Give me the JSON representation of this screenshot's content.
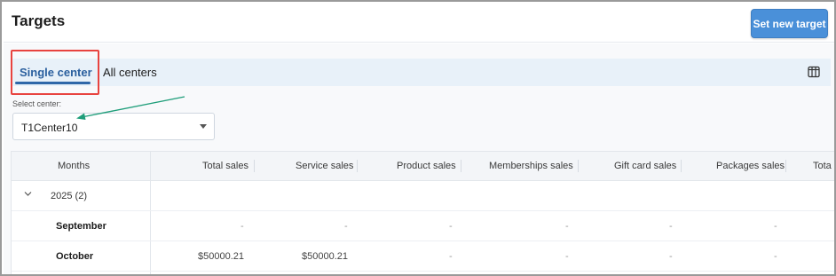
{
  "page": {
    "title": "Targets"
  },
  "header": {
    "set_target_label": "Set new target"
  },
  "tabs": [
    {
      "label": "Single center",
      "active": true
    },
    {
      "label": "All centers",
      "active": false
    }
  ],
  "icons": {
    "columns": "columns-icon",
    "dropdown": "chevron-down-icon",
    "expand": "chevron-down-icon"
  },
  "select": {
    "label": "Select center:",
    "value": "T1Center10"
  },
  "annotation": {
    "highlight_color": "#e8433f",
    "arrow_color": "#1f9e7a"
  },
  "table": {
    "columns": [
      "Months",
      "Total sales",
      "Service sales",
      "Product sales",
      "Memberships sales",
      "Gift card sales",
      "Packages sales",
      "Tota"
    ],
    "group": {
      "label": "2025",
      "count": "(2)"
    },
    "rows": [
      {
        "month": "September",
        "values": [
          "-",
          "-",
          "-",
          "-",
          "-",
          "-"
        ]
      },
      {
        "month": "October",
        "values": [
          "$50000.21",
          "$50000.21",
          "-",
          "-",
          "-",
          "-"
        ]
      }
    ]
  },
  "colors": {
    "primary_button": "#4a90d9",
    "active_tab": "#2a5f9e",
    "tabbar_bg": "#e8f1f9"
  }
}
